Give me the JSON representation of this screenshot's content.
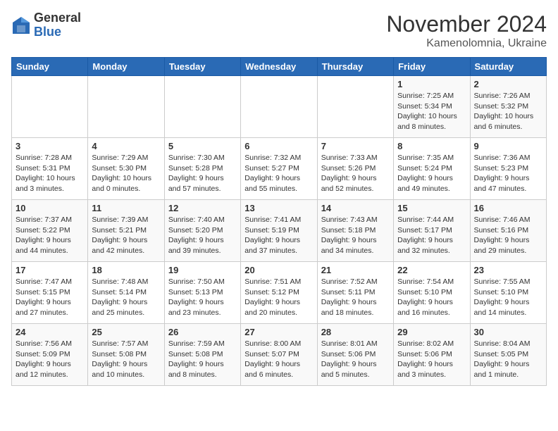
{
  "logo": {
    "general": "General",
    "blue": "Blue"
  },
  "header": {
    "month": "November 2024",
    "location": "Kamenolomnia, Ukraine"
  },
  "weekdays": [
    "Sunday",
    "Monday",
    "Tuesday",
    "Wednesday",
    "Thursday",
    "Friday",
    "Saturday"
  ],
  "weeks": [
    [
      {
        "day": "",
        "info": ""
      },
      {
        "day": "",
        "info": ""
      },
      {
        "day": "",
        "info": ""
      },
      {
        "day": "",
        "info": ""
      },
      {
        "day": "",
        "info": ""
      },
      {
        "day": "1",
        "info": "Sunrise: 7:25 AM\nSunset: 5:34 PM\nDaylight: 10 hours and 8 minutes."
      },
      {
        "day": "2",
        "info": "Sunrise: 7:26 AM\nSunset: 5:32 PM\nDaylight: 10 hours and 6 minutes."
      }
    ],
    [
      {
        "day": "3",
        "info": "Sunrise: 7:28 AM\nSunset: 5:31 PM\nDaylight: 10 hours and 3 minutes."
      },
      {
        "day": "4",
        "info": "Sunrise: 7:29 AM\nSunset: 5:30 PM\nDaylight: 10 hours and 0 minutes."
      },
      {
        "day": "5",
        "info": "Sunrise: 7:30 AM\nSunset: 5:28 PM\nDaylight: 9 hours and 57 minutes."
      },
      {
        "day": "6",
        "info": "Sunrise: 7:32 AM\nSunset: 5:27 PM\nDaylight: 9 hours and 55 minutes."
      },
      {
        "day": "7",
        "info": "Sunrise: 7:33 AM\nSunset: 5:26 PM\nDaylight: 9 hours and 52 minutes."
      },
      {
        "day": "8",
        "info": "Sunrise: 7:35 AM\nSunset: 5:24 PM\nDaylight: 9 hours and 49 minutes."
      },
      {
        "day": "9",
        "info": "Sunrise: 7:36 AM\nSunset: 5:23 PM\nDaylight: 9 hours and 47 minutes."
      }
    ],
    [
      {
        "day": "10",
        "info": "Sunrise: 7:37 AM\nSunset: 5:22 PM\nDaylight: 9 hours and 44 minutes."
      },
      {
        "day": "11",
        "info": "Sunrise: 7:39 AM\nSunset: 5:21 PM\nDaylight: 9 hours and 42 minutes."
      },
      {
        "day": "12",
        "info": "Sunrise: 7:40 AM\nSunset: 5:20 PM\nDaylight: 9 hours and 39 minutes."
      },
      {
        "day": "13",
        "info": "Sunrise: 7:41 AM\nSunset: 5:19 PM\nDaylight: 9 hours and 37 minutes."
      },
      {
        "day": "14",
        "info": "Sunrise: 7:43 AM\nSunset: 5:18 PM\nDaylight: 9 hours and 34 minutes."
      },
      {
        "day": "15",
        "info": "Sunrise: 7:44 AM\nSunset: 5:17 PM\nDaylight: 9 hours and 32 minutes."
      },
      {
        "day": "16",
        "info": "Sunrise: 7:46 AM\nSunset: 5:16 PM\nDaylight: 9 hours and 29 minutes."
      }
    ],
    [
      {
        "day": "17",
        "info": "Sunrise: 7:47 AM\nSunset: 5:15 PM\nDaylight: 9 hours and 27 minutes."
      },
      {
        "day": "18",
        "info": "Sunrise: 7:48 AM\nSunset: 5:14 PM\nDaylight: 9 hours and 25 minutes."
      },
      {
        "day": "19",
        "info": "Sunrise: 7:50 AM\nSunset: 5:13 PM\nDaylight: 9 hours and 23 minutes."
      },
      {
        "day": "20",
        "info": "Sunrise: 7:51 AM\nSunset: 5:12 PM\nDaylight: 9 hours and 20 minutes."
      },
      {
        "day": "21",
        "info": "Sunrise: 7:52 AM\nSunset: 5:11 PM\nDaylight: 9 hours and 18 minutes."
      },
      {
        "day": "22",
        "info": "Sunrise: 7:54 AM\nSunset: 5:10 PM\nDaylight: 9 hours and 16 minutes."
      },
      {
        "day": "23",
        "info": "Sunrise: 7:55 AM\nSunset: 5:10 PM\nDaylight: 9 hours and 14 minutes."
      }
    ],
    [
      {
        "day": "24",
        "info": "Sunrise: 7:56 AM\nSunset: 5:09 PM\nDaylight: 9 hours and 12 minutes."
      },
      {
        "day": "25",
        "info": "Sunrise: 7:57 AM\nSunset: 5:08 PM\nDaylight: 9 hours and 10 minutes."
      },
      {
        "day": "26",
        "info": "Sunrise: 7:59 AM\nSunset: 5:08 PM\nDaylight: 9 hours and 8 minutes."
      },
      {
        "day": "27",
        "info": "Sunrise: 8:00 AM\nSunset: 5:07 PM\nDaylight: 9 hours and 6 minutes."
      },
      {
        "day": "28",
        "info": "Sunrise: 8:01 AM\nSunset: 5:06 PM\nDaylight: 9 hours and 5 minutes."
      },
      {
        "day": "29",
        "info": "Sunrise: 8:02 AM\nSunset: 5:06 PM\nDaylight: 9 hours and 3 minutes."
      },
      {
        "day": "30",
        "info": "Sunrise: 8:04 AM\nSunset: 5:05 PM\nDaylight: 9 hours and 1 minute."
      }
    ]
  ]
}
